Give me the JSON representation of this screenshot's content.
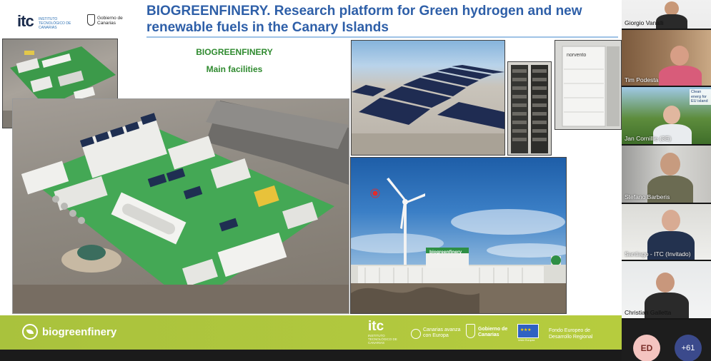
{
  "slide": {
    "title": "BIOGREENFINERY. Research platform for Green hydrogen and new renewable fuels in the Canary Islands",
    "subtitle_1": "BIOGREENFINERY",
    "subtitle_2": "Main facilities",
    "header_logos": {
      "itc_mark": "itc",
      "itc_sub": "INSTITUTO TECNOLÓGICO DE CANARIAS",
      "gobierno": "Gobierno de Canarias"
    },
    "photo_labels": {
      "cabinet_brand": "norvento",
      "container_brand": "biogreenfinery"
    },
    "footer": {
      "brand": "biogreenfinery",
      "itc_mark": "itc",
      "itc_sub": "INSTITUTO TECNOLÓGICO DE CANARIAS",
      "canarias": "Canarias avanza con Europa",
      "gobierno": "Gobierno de Canarias",
      "eu": "Unión Europea",
      "fondo": "Fondo Europeo de Desarrollo Regional"
    }
  },
  "participants": [
    {
      "name": "Giorgio Vanalli"
    },
    {
      "name": "Tim Podesta"
    },
    {
      "name": "Jan Cornillie (3E)",
      "overlay_text": "Clean energ for EU island"
    },
    {
      "name": "Stefano Barberis"
    },
    {
      "name": "Santiago - ITC (Invitado)"
    },
    {
      "name": "Christian Galletta"
    }
  ],
  "bottom": {
    "avatar_initials": "ED",
    "more_count": "+61"
  },
  "colors": {
    "title_blue": "#2e5fa8",
    "subtitle_green": "#2f8a2f",
    "footer_green": "#b0c83d",
    "avatar_pink": "#f4c4c0",
    "more_badge": "#3b4a8c"
  }
}
